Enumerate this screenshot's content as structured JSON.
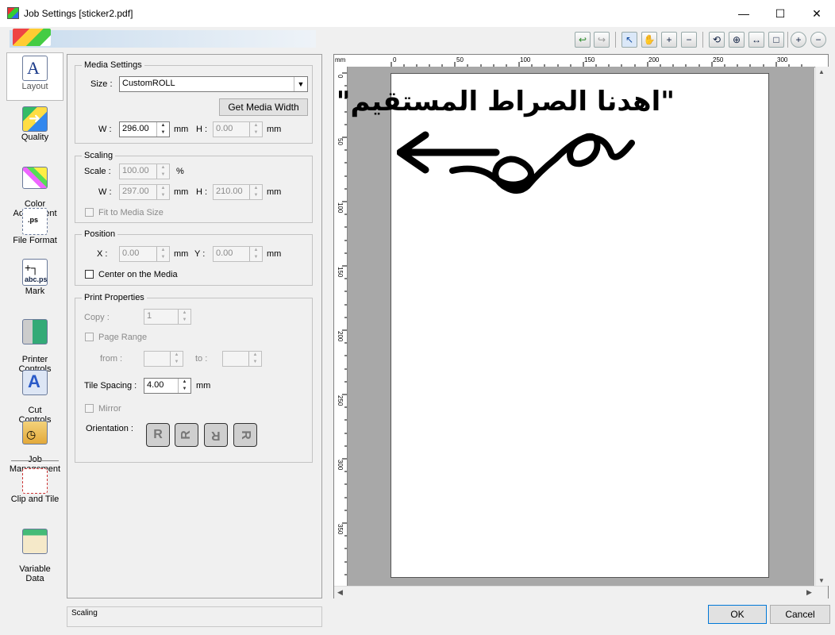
{
  "window": {
    "title": "Job Settings [sticker2.pdf]",
    "minimize": "—",
    "maximize": "☐",
    "close": "✕"
  },
  "toolbar": {
    "undo": "↩",
    "redo": "↪",
    "select": "↖",
    "pan": "✋",
    "zoom_in": "+",
    "zoom_out": "−",
    "rotate": "⟲",
    "center": "⊕",
    "fit_width": "↔",
    "fit_page": "□",
    "plus": "+",
    "minus": "−"
  },
  "sidebar": {
    "items": [
      {
        "label": "Layout",
        "icon": "layout-icon"
      },
      {
        "label": "Quality",
        "icon": "quality-icon"
      },
      {
        "label": "Color\nAdjustment",
        "icon": "color-adjustment-icon"
      },
      {
        "label": "File Format",
        "icon": "file-format-icon"
      },
      {
        "label": "Mark",
        "icon": "mark-icon"
      },
      {
        "label": "Printer\nControls",
        "icon": "printer-controls-icon"
      },
      {
        "label": "Cut\nControls",
        "icon": "cut-controls-icon"
      },
      {
        "label": "Job\nManagement",
        "icon": "job-management-icon"
      },
      {
        "label": "Clip and Tile",
        "icon": "clip-tile-icon"
      },
      {
        "label": "Variable\nData",
        "icon": "variable-data-icon"
      }
    ]
  },
  "media": {
    "legend": "Media Settings",
    "size_label": "Size :",
    "size_value": "CustomROLL",
    "get_width_button": "Get Media Width",
    "w_label": "W :",
    "w_value": "296.00",
    "w_unit": "mm",
    "h_label": "H :",
    "h_value": "0.00",
    "h_unit": "mm"
  },
  "scaling": {
    "legend": "Scaling",
    "scale_label": "Scale :",
    "scale_value": "100.00",
    "scale_unit": "%",
    "w_label": "W :",
    "w_value": "297.00",
    "w_unit": "mm",
    "h_label": "H :",
    "h_value": "210.00",
    "h_unit": "mm",
    "fit_label": "Fit to Media Size"
  },
  "position": {
    "legend": "Position",
    "x_label": "X :",
    "x_value": "0.00",
    "x_unit": "mm",
    "y_label": "Y :",
    "y_value": "0.00",
    "y_unit": "mm",
    "center_label": "Center on the Media"
  },
  "print": {
    "legend": "Print Properties",
    "copy_label": "Copy :",
    "copy_value": "1",
    "page_range_label": "Page Range",
    "from_label": "from :",
    "to_label": "to :",
    "tile_label": "Tile Spacing :",
    "tile_value": "4.00",
    "tile_unit": "mm",
    "mirror_label": "Mirror",
    "orientation_label": "Orientation :",
    "orient_glyphs": [
      "R",
      "R",
      "R",
      "R"
    ]
  },
  "ruler": {
    "top": [
      "mm",
      "0",
      "50",
      "100",
      "150",
      "200",
      "250",
      "300"
    ],
    "left": [
      "0",
      "50",
      "100",
      "150",
      "200",
      "250",
      "300",
      "350"
    ]
  },
  "artwork": {
    "text": "\"اهدنا الصراط المستقيم\""
  },
  "status": {
    "text": "Scaling"
  },
  "buttons": {
    "ok": "OK",
    "cancel": "Cancel"
  }
}
